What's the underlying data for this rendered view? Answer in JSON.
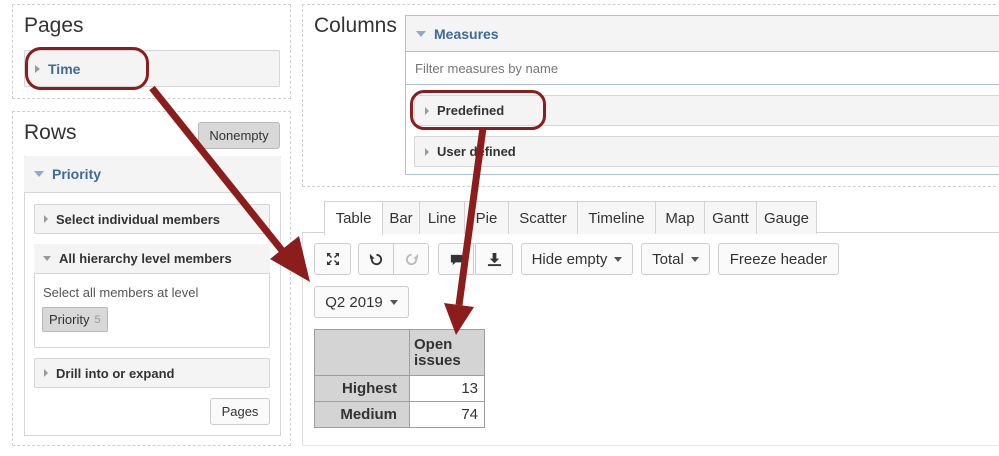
{
  "pages": {
    "title": "Pages",
    "item": "Time"
  },
  "rows": {
    "title": "Rows",
    "nonempty_button": "Nonempty",
    "dimension": "Priority",
    "sections": {
      "select_individual": "Select individual members",
      "all_hierarchy": "All hierarchy level members",
      "select_all_text": "Select all members at level",
      "level_chip": "Priority",
      "level_count": "5",
      "drill": "Drill into or expand"
    },
    "pages_button": "Pages"
  },
  "columns": {
    "title": "Columns",
    "measures_title": "Measures",
    "filter_placeholder": "Filter measures by name",
    "predefined": "Predefined",
    "user_defined": "User defined"
  },
  "tabs": [
    "Table",
    "Bar",
    "Line",
    "Pie",
    "Scatter",
    "Timeline",
    "Map",
    "Gantt",
    "Gauge"
  ],
  "toolbar": {
    "hide_empty": "Hide empty",
    "total": "Total",
    "freeze_header": "Freeze header",
    "page_selector": "Q2 2019"
  },
  "result_table": {
    "column_header": "Open issues",
    "rows": [
      {
        "label": "Highest",
        "value": "13"
      },
      {
        "label": "Medium",
        "value": "74"
      }
    ]
  },
  "colors": {
    "annotation": "#8b1d1d",
    "link_blue": "#3d6a98"
  }
}
